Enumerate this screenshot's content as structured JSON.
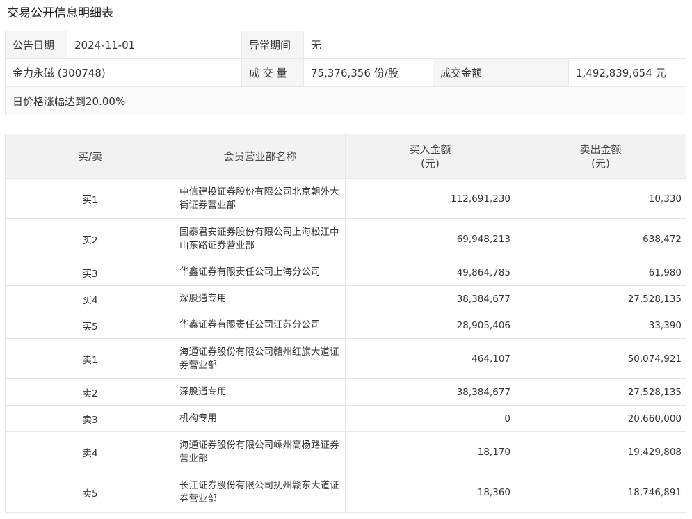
{
  "page_title": "交易公开信息明细表",
  "info": {
    "announce_date_label": "公告日期",
    "announce_date": "2024-11-01",
    "abnormal_period_label": "异常期间",
    "abnormal_period": "无",
    "stock": "金力永磁 (300748)",
    "volume_label": "成 交 量",
    "volume": "75,376,356 份/股",
    "turnover_label": "成交金额",
    "turnover": "1,492,839,654 元",
    "reason": "日价格涨幅达到20.00%"
  },
  "columns": {
    "side": "买/卖",
    "member": "会员营业部名称",
    "buy_amount": "买入金额",
    "buy_unit": "(元)",
    "sell_amount": "卖出金额",
    "sell_unit": "(元)"
  },
  "rows": [
    {
      "side": "买1",
      "member": "中信建投证券股份有限公司北京朝外大街证券营业部",
      "buy": "112,691,230",
      "sell": "10,330"
    },
    {
      "side": "买2",
      "member": "国泰君安证券股份有限公司上海松江中山东路证券营业部",
      "buy": "69,948,213",
      "sell": "638,472"
    },
    {
      "side": "买3",
      "member": "华鑫证券有限责任公司上海分公司",
      "buy": "49,864,785",
      "sell": "61,980"
    },
    {
      "side": "买4",
      "member": "深股通专用",
      "buy": "38,384,677",
      "sell": "27,528,135"
    },
    {
      "side": "买5",
      "member": "华鑫证券有限责任公司江苏分公司",
      "buy": "28,905,406",
      "sell": "33,390"
    },
    {
      "side": "卖1",
      "member": "海通证券股份有限公司赣州红旗大道证券营业部",
      "buy": "464,107",
      "sell": "50,074,921"
    },
    {
      "side": "卖2",
      "member": "深股通专用",
      "buy": "38,384,677",
      "sell": "27,528,135"
    },
    {
      "side": "卖3",
      "member": "机构专用",
      "buy": "0",
      "sell": "20,660,000"
    },
    {
      "side": "卖4",
      "member": "海通证券股份有限公司嵊州高杨路证券营业部",
      "buy": "18,170",
      "sell": "19,429,808"
    },
    {
      "side": "卖5",
      "member": "长江证券股份有限公司抚州赣东大道证券营业部",
      "buy": "18,360",
      "sell": "18,746,891"
    }
  ]
}
